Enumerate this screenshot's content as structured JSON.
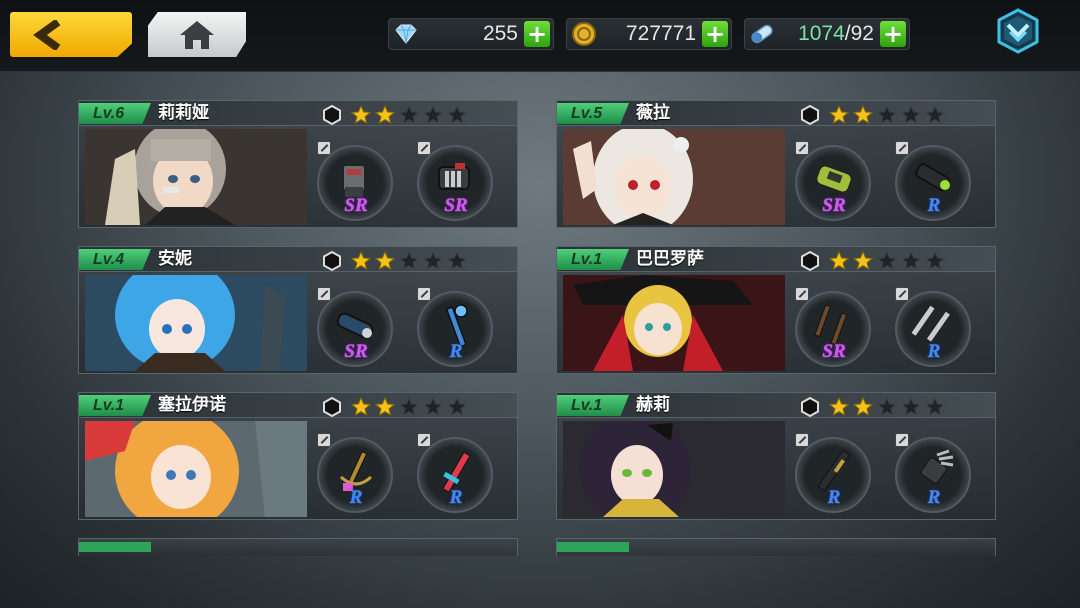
{
  "topbar": {
    "back_icon": "chevron-left-icon",
    "home_icon": "home-icon",
    "menu_icon": "chevron-down-shield-icon",
    "currencies": [
      {
        "id": "diamond",
        "icon": "diamond-icon",
        "value": "255"
      },
      {
        "id": "gold",
        "icon": "gold-coin-icon",
        "value": "727771"
      },
      {
        "id": "stamina",
        "icon": "stamina-capsule-icon",
        "current": "1074",
        "max": "/92"
      }
    ]
  },
  "characters": [
    {
      "level": "Lv.6",
      "name": "莉莉娅",
      "stars_filled": 2,
      "stars_total": 5,
      "portrait": "gray-hair-girl",
      "equip": [
        {
          "rarity": "SR",
          "weapon": "gauntlet-icon"
        },
        {
          "rarity": "SR",
          "weapon": "gatling-gun-icon"
        }
      ]
    },
    {
      "level": "Lv.5",
      "name": "薇拉",
      "stars_filled": 2,
      "stars_total": 5,
      "portrait": "white-hair-girl",
      "equip": [
        {
          "rarity": "SR",
          "weapon": "death-canister-icon"
        },
        {
          "rarity": "R",
          "weapon": "blaster-icon"
        }
      ]
    },
    {
      "level": "Lv.4",
      "name": "安妮",
      "stars_filled": 2,
      "stars_total": 5,
      "portrait": "blue-hair-girl",
      "equip": [
        {
          "rarity": "SR",
          "weapon": "cannon-icon"
        },
        {
          "rarity": "R",
          "weapon": "staff-icon"
        }
      ]
    },
    {
      "level": "Lv.1",
      "name": "巴巴罗萨",
      "stars_filled": 2,
      "stars_total": 5,
      "portrait": "pirate-girl",
      "equip": [
        {
          "rarity": "SR",
          "weapon": "twin-pistols-icon"
        },
        {
          "rarity": "R",
          "weapon": "twin-blades-icon"
        }
      ]
    },
    {
      "level": "Lv.1",
      "name": "塞拉伊诺",
      "stars_filled": 2,
      "stars_total": 5,
      "portrait": "blonde-girl",
      "equip": [
        {
          "rarity": "R",
          "weapon": "anchor-sword-icon"
        },
        {
          "rarity": "R",
          "weapon": "red-blade-icon"
        }
      ]
    },
    {
      "level": "Lv.1",
      "name": "赫莉",
      "stars_filled": 2,
      "stars_total": 5,
      "portrait": "dark-hair-girl",
      "equip": [
        {
          "rarity": "R",
          "weapon": "rifle-icon"
        },
        {
          "rarity": "R",
          "weapon": "claw-icon"
        }
      ]
    }
  ],
  "colors": {
    "level_badge": "#2ea35a",
    "star_gold": "#f5c21b",
    "star_empty": "#1e2326",
    "rarity_sr": "#d456f2",
    "rarity_r": "#3e88ff",
    "plus_green": "#3cc01b",
    "back_yellow": "#f5bf0f"
  }
}
